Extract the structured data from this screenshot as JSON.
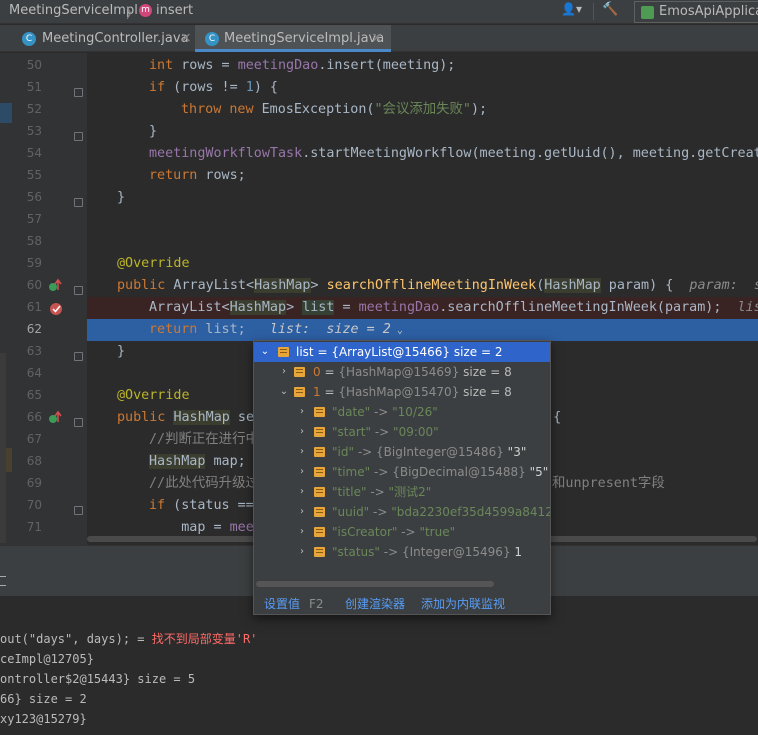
{
  "breadcrumb": {
    "class_name": "MeetingServiceImpl",
    "method_name": "insert",
    "separator": "〉",
    "method_icon_letter": "m"
  },
  "toolbar": {
    "run_config": "EmosApiApplicat",
    "user_icon_glyph": "👤▾",
    "build_icon_glyph": "🔨"
  },
  "tabs": [
    {
      "label": "MeetingController.java",
      "icon_letter": "C",
      "close": "×",
      "active": false
    },
    {
      "label": "MeetingServiceImpl.java",
      "icon_letter": "C",
      "close": "×",
      "active": true
    }
  ],
  "editor": {
    "line_numbers": [
      "50",
      "51",
      "52",
      "53",
      "54",
      "55",
      "56",
      "57",
      "58",
      "59",
      "60",
      "61",
      "62",
      "63",
      "64",
      "65",
      "66",
      "67",
      "68",
      "69",
      "70",
      "71"
    ],
    "current_line": "62",
    "lines": {
      "l50": {
        "kw": "int",
        "var": " rows = ",
        "fld": "meetingDao",
        "rest": ".insert(meeting);"
      },
      "l51": {
        "kw": "if",
        "a": " (rows != ",
        "num": "1",
        "b": ") {"
      },
      "l52": {
        "kw1": "throw",
        "kw2": " new",
        "a": " EmosException(",
        "str": "\"会议添加失败\"",
        "b": ");"
      },
      "l53": "}",
      "l54": {
        "fld": "meetingWorkflowTask",
        "rest": ".startMeetingWorkflow(meeting.getUuid(), meeting.getCreat"
      },
      "l55": {
        "kw": "return",
        "rest": " rows;"
      },
      "l56": "}",
      "l59": "@Override",
      "l60": {
        "kw": "public",
        "a": " ArrayList<",
        "g": "HashMap",
        "b": "> ",
        "fn": "searchOfflineMeetingInWeek",
        "c": "(",
        "g2": "HashMap",
        "d": " param) {",
        "hint": "  param:  s"
      },
      "l61": {
        "a": "ArrayList<",
        "g": "HashMap",
        "b": "> ",
        "hlv": "list",
        "c": " = ",
        "fld": "meetingDao",
        "d": ".searchOfflineMeetingInWeek(param);",
        "hint": "  list"
      },
      "l62": {
        "kw": "return",
        "a": " list;",
        "inline": "   list:  size = 2"
      },
      "l63": "}",
      "l65": "@Override",
      "l66": {
        "kw": "public",
        "sp": " ",
        "g": "HashMap",
        "a": " se",
        "b": ") {"
      },
      "l67": "//判断正在进行中",
      "l68": {
        "g": "HashMap",
        "a": " map;"
      },
      "l69": {
        "c1": "//此处代码升级过",
        "c2": "和unpresent字段"
      },
      "l70": {
        "kw": "if",
        "a": " (status ==="
      },
      "l71": {
        "a": "    map = ",
        "fld": "mee"
      }
    }
  },
  "debug_popup": {
    "root": {
      "name": "list",
      "type": "{ArrayList@15466}",
      "size": "size = 2"
    },
    "items": [
      {
        "name": "0",
        "type": "{HashMap@15469}",
        "size": "size = 8"
      },
      {
        "name": "1",
        "type": "{HashMap@15470}",
        "size": "size = 8"
      }
    ],
    "entries": [
      {
        "key": "\"date\"",
        "value": "\"10/26\""
      },
      {
        "key": "\"start\"",
        "value": "\"09:00\""
      },
      {
        "key": "\"id\"",
        "value": "{BigInteger@15486}",
        "extra": "\"3\""
      },
      {
        "key": "\"time\"",
        "value": "{BigDecimal@15488}",
        "extra": "\"5\""
      },
      {
        "key": "\"title\"",
        "value": "\"测试2\""
      },
      {
        "key": "\"uuid\"",
        "value": "\"bda2230ef35d4599a84127a"
      },
      {
        "key": "\"isCreator\"",
        "value": "\"true\""
      },
      {
        "key": "\"status\"",
        "value": "{Integer@15496}",
        "extra": "1"
      }
    ],
    "arrow": "->",
    "expand_arrow": "›",
    "collapse_arrow": "⌄",
    "footer": {
      "set_value": "设置值",
      "set_value_key": "F2",
      "create_renderer": "创建渲染器",
      "add_watch": "添加为内联监视"
    }
  },
  "debug_console": {
    "lines": [
      {
        "a": "out(\"days\", days); = ",
        "err": "找不到局部变量'R'"
      },
      {
        "a": "ceImpl@12705}"
      },
      {
        "a": "ontroller$2@15443}  size = 5"
      },
      {
        "a": "66}  size = 2"
      },
      {
        "a": "xy123@15279}"
      }
    ]
  }
}
